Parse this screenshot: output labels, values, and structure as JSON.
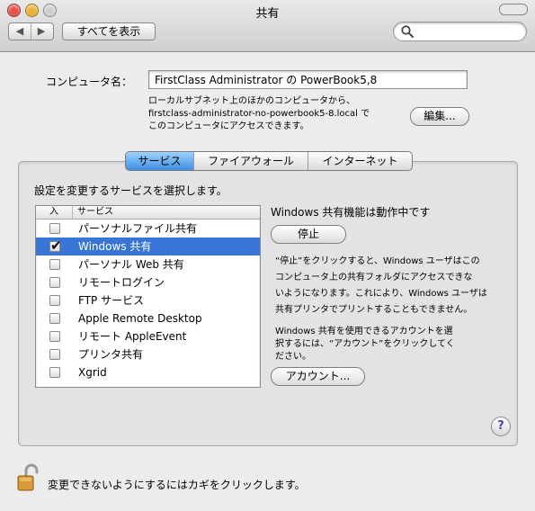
{
  "window": {
    "title": "共有"
  },
  "toolbar": {
    "back_icon": "◀",
    "forward_icon": "▶",
    "show_all_label": "すべてを表示",
    "search": {
      "value": "",
      "placeholder": ""
    }
  },
  "computer": {
    "name_label": "コンピュータ名：",
    "name_value": "FirstClass Administrator の PowerBook5,8",
    "access_lines": [
      "ローカルサブネット上のほかのコンピュータから、",
      "firstclass-administrator-no-powerbook5-8.local で",
      "このコンピュータにアクセスできます。"
    ],
    "edit_label": "編集..."
  },
  "tabs": [
    {
      "label": "サービス",
      "selected": true
    },
    {
      "label": "ファイアウォール",
      "selected": false
    },
    {
      "label": "インターネット",
      "selected": false
    }
  ],
  "services": {
    "instruction": "設定を変更するサービスを選択します。",
    "col_on": "入",
    "col_service": "サービス",
    "items": [
      {
        "name": "パーソナルファイル共有",
        "checked": false,
        "selected": false
      },
      {
        "name": "Windows 共有",
        "checked": true,
        "selected": true
      },
      {
        "name": "パーソナル Web 共有",
        "checked": false,
        "selected": false
      },
      {
        "name": "リモートログイン",
        "checked": false,
        "selected": false
      },
      {
        "name": "FTP サービス",
        "checked": false,
        "selected": false
      },
      {
        "name": "Apple Remote Desktop",
        "checked": false,
        "selected": false
      },
      {
        "name": "リモート AppleEvent",
        "checked": false,
        "selected": false
      },
      {
        "name": "プリンタ共有",
        "checked": false,
        "selected": false
      },
      {
        "name": "Xgrid",
        "checked": false,
        "selected": false
      }
    ],
    "check_mark": "✔"
  },
  "detail": {
    "status": "Windows 共有機能は動作中です",
    "stop_label": "停止",
    "desc_lines": [
      "“停止”をクリックすると、Windows ユーザはこの",
      "コンピュータ上の共有フォルダにアクセスできな",
      "いようになります。これにより、Windows ユーザは",
      "共有プリンタでプリントすることもできません。"
    ],
    "account_lines": [
      "Windows 共有を使用できるアカウントを選",
      "択するには、“アカウント”をクリックしてく",
      "ださい。"
    ],
    "account_label": "アカウント...",
    "help_label": "?"
  },
  "lock": {
    "text": "変更できないようにするにはカギをクリックします。"
  },
  "colors": {
    "selection": "#3875d7",
    "tab_selected": "#5fa6f0"
  }
}
